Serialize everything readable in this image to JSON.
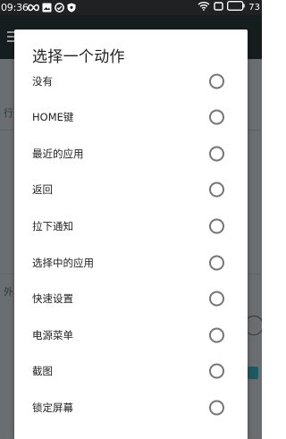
{
  "status_bar": {
    "time": "09:36",
    "battery": "73"
  },
  "background": {
    "items": [
      "行",
      "外"
    ]
  },
  "dialog": {
    "title": "选择一个动作",
    "options": [
      {
        "label": "没有",
        "selected": false
      },
      {
        "label": "HOME键",
        "selected": false
      },
      {
        "label": "最近的应用",
        "selected": false
      },
      {
        "label": "返回",
        "selected": false
      },
      {
        "label": "拉下通知",
        "selected": false
      },
      {
        "label": "选择中的应用",
        "selected": false
      },
      {
        "label": "快速设置",
        "selected": false
      },
      {
        "label": "电源菜单",
        "selected": false
      },
      {
        "label": "截图",
        "selected": false
      },
      {
        "label": "锁定屏幕",
        "selected": false
      }
    ]
  },
  "colors": {
    "scrim": "#6f7274",
    "dialog_bg": "#ffffff",
    "radio_border": "#757575",
    "accent": "#1f5f69"
  }
}
